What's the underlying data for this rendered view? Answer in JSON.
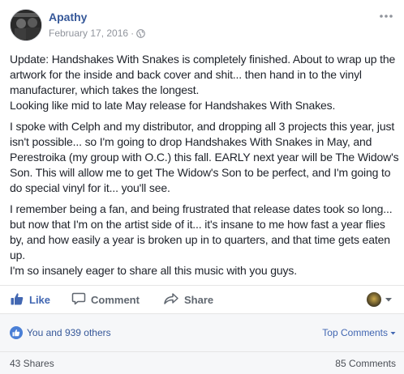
{
  "post": {
    "author": "Apathy",
    "date": "February 17, 2016",
    "separator": "·",
    "privacy_icon": "globe-icon",
    "paragraphs": [
      "Update: Handshakes With Snakes is completely finished. About to wrap up the artwork for the inside and back cover and shit... then hand in to the vinyl manufacturer, which takes the longest.\nLooking like mid to late May release for Handshakes With Snakes.",
      "I spoke with Celph and my distributor, and dropping all 3 projects this year, just isn't possible... so I'm going to drop Handshakes With Snakes in May, and Perestroika (my group with O.C.) this fall. EARLY next year will be The Widow's Son. This will allow me to get The Widow's Son to be perfect, and I'm going to do special vinyl for it... you'll see.",
      "I remember being a fan, and being frustrated that release dates took so long... but now that I'm on the artist side of it... it's insane to me how fast a year flies by, and how easily a year is broken up in to quarters, and that time gets eaten up.\nI'm so insanely eager to share all this music with you guys."
    ]
  },
  "actions": {
    "like_label": "Like",
    "comment_label": "Comment",
    "share_label": "Share"
  },
  "reactions": {
    "summary": "You and 939 others",
    "top_comments_label": "Top Comments"
  },
  "counts": {
    "shares": "43 Shares",
    "comments": "85 Comments"
  },
  "colors": {
    "link_blue": "#365899",
    "like_blue": "#4267b2",
    "muted": "#90949c",
    "text": "#1d2129"
  }
}
